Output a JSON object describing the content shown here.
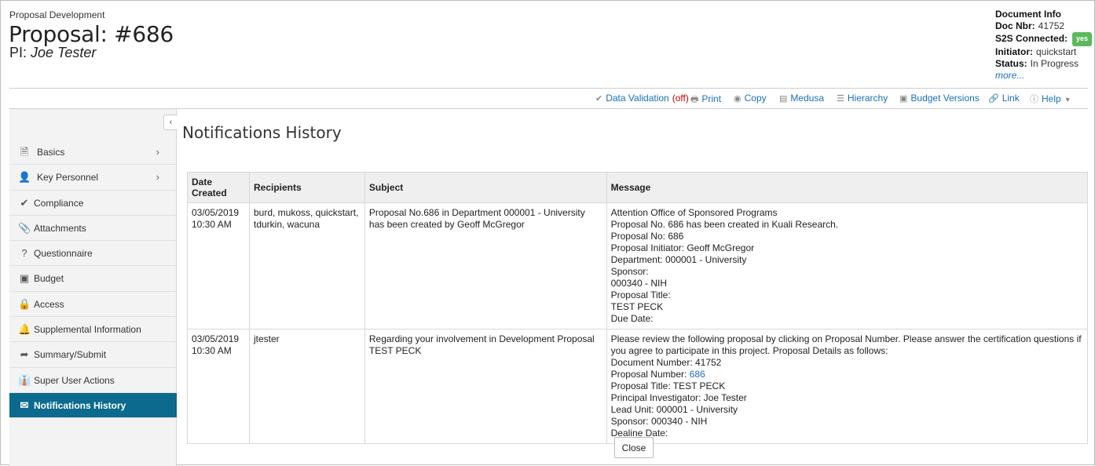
{
  "header": {
    "module": "Proposal Development",
    "title": "Proposal: #686",
    "pi_label": "PI:",
    "pi_name": "Joe Tester"
  },
  "document_info": {
    "title": "Document Info",
    "doc_nbr_label": "Doc Nbr:",
    "doc_nbr": "41752",
    "s2s_label": "S2S Connected:",
    "s2s_value": "yes",
    "initiator_label": "Initiator:",
    "initiator": "quickstart",
    "status_label": "Status:",
    "status": "In Progress",
    "more_link": "more..."
  },
  "toolbar": {
    "data_validation": "Data Validation",
    "data_validation_state": "(off)",
    "print": "Print",
    "copy": "Copy",
    "medusa": "Medusa",
    "hierarchy": "Hierarchy",
    "budget_versions": "Budget Versions",
    "link": "Link",
    "help": "Help"
  },
  "sidebar": {
    "items": [
      {
        "label": "Basics",
        "icon": "document-icon"
      },
      {
        "label": "Key Personnel",
        "icon": "person-icon"
      },
      {
        "label": "Compliance",
        "icon": "check-icon"
      },
      {
        "label": "Attachments",
        "icon": "paperclip-icon"
      },
      {
        "label": "Questionnaire",
        "icon": "question-circle-icon"
      },
      {
        "label": "Budget",
        "icon": "money-icon"
      },
      {
        "label": "Access",
        "icon": "lock-icon"
      },
      {
        "label": "Supplemental Information",
        "icon": "bell-icon"
      },
      {
        "label": "Summary/Submit",
        "icon": "share-icon"
      },
      {
        "label": "Super User Actions",
        "icon": "user-tie-icon"
      },
      {
        "label": "Notifications History",
        "icon": "envelope-icon"
      }
    ]
  },
  "main": {
    "title": "Notifications History",
    "columns": [
      "Date Created",
      "Recipients",
      "Subject",
      "Message"
    ],
    "rows": [
      {
        "date": "03/05/2019",
        "time": "10:30 AM",
        "recipients": "burd, mukoss, quickstart, tdurkin, wacuna",
        "subject": "Proposal No.686 in Department 000001 - University has been created by Geoff McGregor",
        "message": [
          "Attention Office of Sponsored Programs",
          "Proposal No. 686 has been created in Kuali Research.",
          "Proposal No: 686",
          "Proposal Initiator: Geoff McGregor",
          "Department: 000001 - University",
          "Sponsor:",
          "000340 - NIH",
          "Proposal Title:",
          "TEST PECK",
          "Due Date:"
        ]
      },
      {
        "date": "03/05/2019",
        "time": "10:30 AM",
        "recipients": "jtester",
        "subject": "Regarding your involvement in Development Proposal TEST PECK",
        "message_intro": "Please review the following proposal by clicking on Proposal Number. Please answer the certification questions if you agree to participate in this project. Proposal Details as follows:",
        "doc_number": "Document Number: 41752",
        "proposal_number_label": "Proposal Number:",
        "proposal_number_link": "686",
        "proposal_title": "Proposal Title: TEST PECK",
        "pi": "Principal Investigator: Joe Tester",
        "lead_unit": "Lead Unit: 000001 - University",
        "sponsor": "Sponsor: 000340 - NIH",
        "deadline": "Dealine Date:"
      }
    ],
    "close_label": "Close"
  }
}
